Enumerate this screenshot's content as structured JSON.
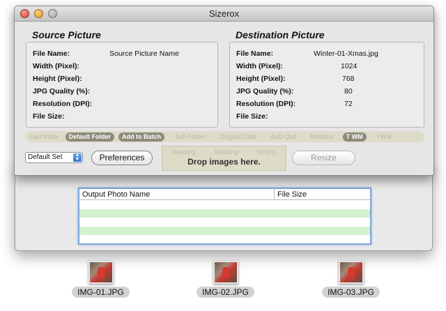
{
  "window": {
    "title": "Sizerox"
  },
  "source": {
    "heading": "Source Picture",
    "fields": [
      {
        "label": "File Name:",
        "value": "Source Picture Name"
      },
      {
        "label": "Width (Pixel):",
        "value": ""
      },
      {
        "label": "Height (Pixel):",
        "value": ""
      },
      {
        "label": "JPG Quality (%):",
        "value": ""
      },
      {
        "label": "Resolution (DPI):",
        "value": ""
      },
      {
        "label": "File Size:",
        "value": ""
      }
    ]
  },
  "destination": {
    "heading": "Destination Picture",
    "fields": [
      {
        "label": "File Name:",
        "value": "Winter-01-Xmas.jpg"
      },
      {
        "label": "Width (Pixel):",
        "value": "1024"
      },
      {
        "label": "Height (Pixel):",
        "value": "768"
      },
      {
        "label": "JPG Quality (%):",
        "value": "80"
      },
      {
        "label": "Resolution (DPI):",
        "value": "72"
      },
      {
        "label": "File Size:",
        "value": ""
      }
    ]
  },
  "options": [
    {
      "label": "Last Index",
      "active": false
    },
    {
      "label": "Default Folder",
      "active": true
    },
    {
      "label": "Add to Batch",
      "active": true
    },
    {
      "label": "Sub Folder",
      "active": false
    },
    {
      "label": "Original Date",
      "active": false
    },
    {
      "label": "Auto Quit",
      "active": false
    },
    {
      "label": "Rotation",
      "active": false
    },
    {
      "label": "T WM",
      "active": true
    },
    {
      "label": "I WM",
      "active": false
    }
  ],
  "controls": {
    "preset_select": "Default Set",
    "preferences_label": "Preferences",
    "resize_label": "Resize",
    "drop_steps": [
      "Reading",
      "Resizing",
      "Writing"
    ],
    "drop_text": "Drop images here."
  },
  "output_table": {
    "columns": [
      "Output Photo Name",
      "File Size"
    ],
    "rows": []
  },
  "desktop_icons": [
    "IMG-01.JPG",
    "IMG-02.JPG",
    "IMG-03.JPG"
  ],
  "colors": {
    "active_option": "#8d8b7a",
    "stripe_green": "#d6f0d2",
    "table_focus": "#7ea6d9"
  }
}
